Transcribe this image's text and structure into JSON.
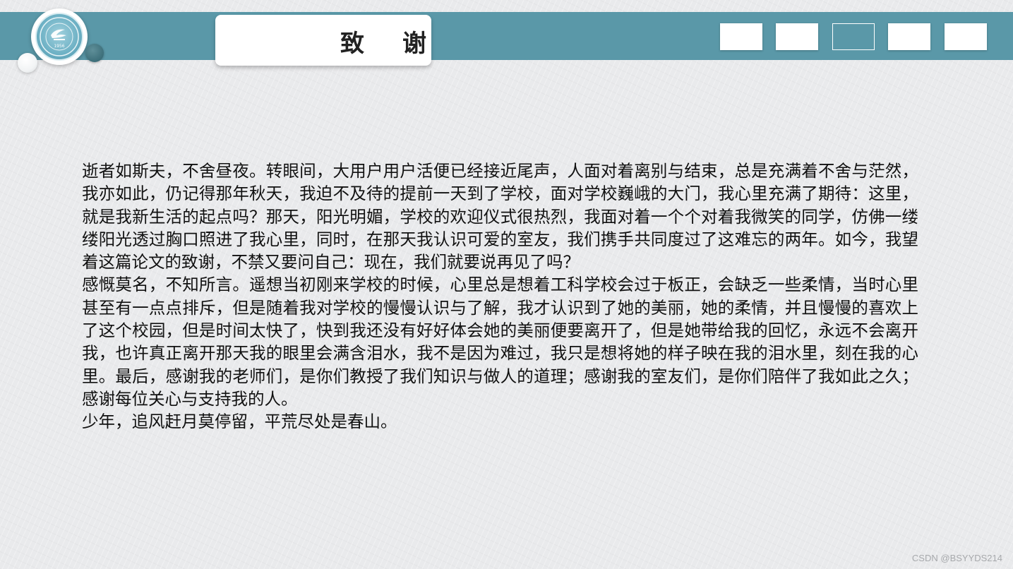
{
  "title": "致谢",
  "paragraphs": [
    "逝者如斯夫，不舍昼夜。转眼间，大用户用户活便已经接近尾声，人面对着离别与结束，总是充满着不舍与茫然，我亦如此，仍记得那年秋天，我迫不及待的提前一天到了学校，面对学校巍峨的大门，我心里充满了期待：这里，就是我新生活的起点吗？那天，阳光明媚，学校的欢迎仪式很热烈，我面对着一个个对着我微笑的同学，仿佛一缕缕阳光透过胸口照进了我心里，同时，在那天我认识可爱的室友，我们携手共同度过了这难忘的两年。如今，我望着这篇论文的致谢，不禁又要问自己：现在，我们就要说再见了吗？",
    "感慨莫名，不知所言。遥想当初刚来学校的时候，心里总是想着工科学校会过于板正，会缺乏一些柔情，当时心里甚至有一点点排斥，但是随着我对学校的慢慢认识与了解，我才认识到了她的美丽，她的柔情，并且慢慢的喜欢上了这个校园，但是时间太快了，快到我还没有好好体会她的美丽便要离开了，但是她带给我的回忆，永远不会离开我，也许真正离开那天我的眼里会满含泪水，我不是因为难过，我只是想将她的样子映在我的泪水里，刻在我的心里。最后，感谢我的老师们，是你们教授了我们知识与做人的道理；感谢我的室友们，是你们陪伴了我如此之久；感谢每位关心与支持我的人。",
    "少年，追风赶月莫停留，平荒尽处是春山。"
  ],
  "logo": {
    "year": "1956",
    "icon": "university-emblem-icon"
  },
  "nav_buttons": [
    {
      "active": false
    },
    {
      "active": false
    },
    {
      "active": true
    },
    {
      "active": false
    },
    {
      "active": false
    }
  ],
  "watermark": "CSDN @BSYYDS214",
  "colors": {
    "band": "#5a98a8",
    "background": "#e9eaec",
    "text": "#111111"
  }
}
